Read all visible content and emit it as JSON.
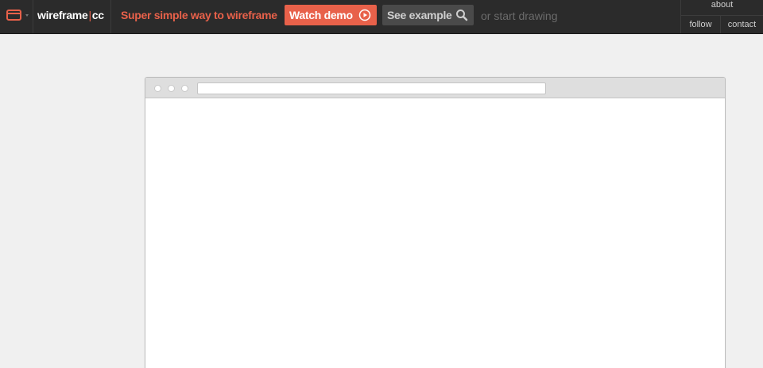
{
  "header": {
    "logo_icon": "browser-window-icon",
    "brand_name": "wireframe",
    "brand_separator": "|",
    "brand_suffix": "cc",
    "tagline": "Super simple way to wireframe",
    "watch_demo_label": "Watch demo",
    "watch_demo_icon": "play-circle-icon",
    "see_example_label": "See example",
    "see_example_icon": "search-icon",
    "start_drawing_text": "or start drawing"
  },
  "nav": {
    "about": "about",
    "follow": "follow",
    "contact": "contact"
  },
  "canvas": {
    "mockup_type": "browser-window",
    "address_value": ""
  },
  "colors": {
    "accent": "#e8614a",
    "topbar_bg": "#2b2b2b",
    "page_bg": "#f0f0f0",
    "secondary_button": "#4a4a4a"
  }
}
